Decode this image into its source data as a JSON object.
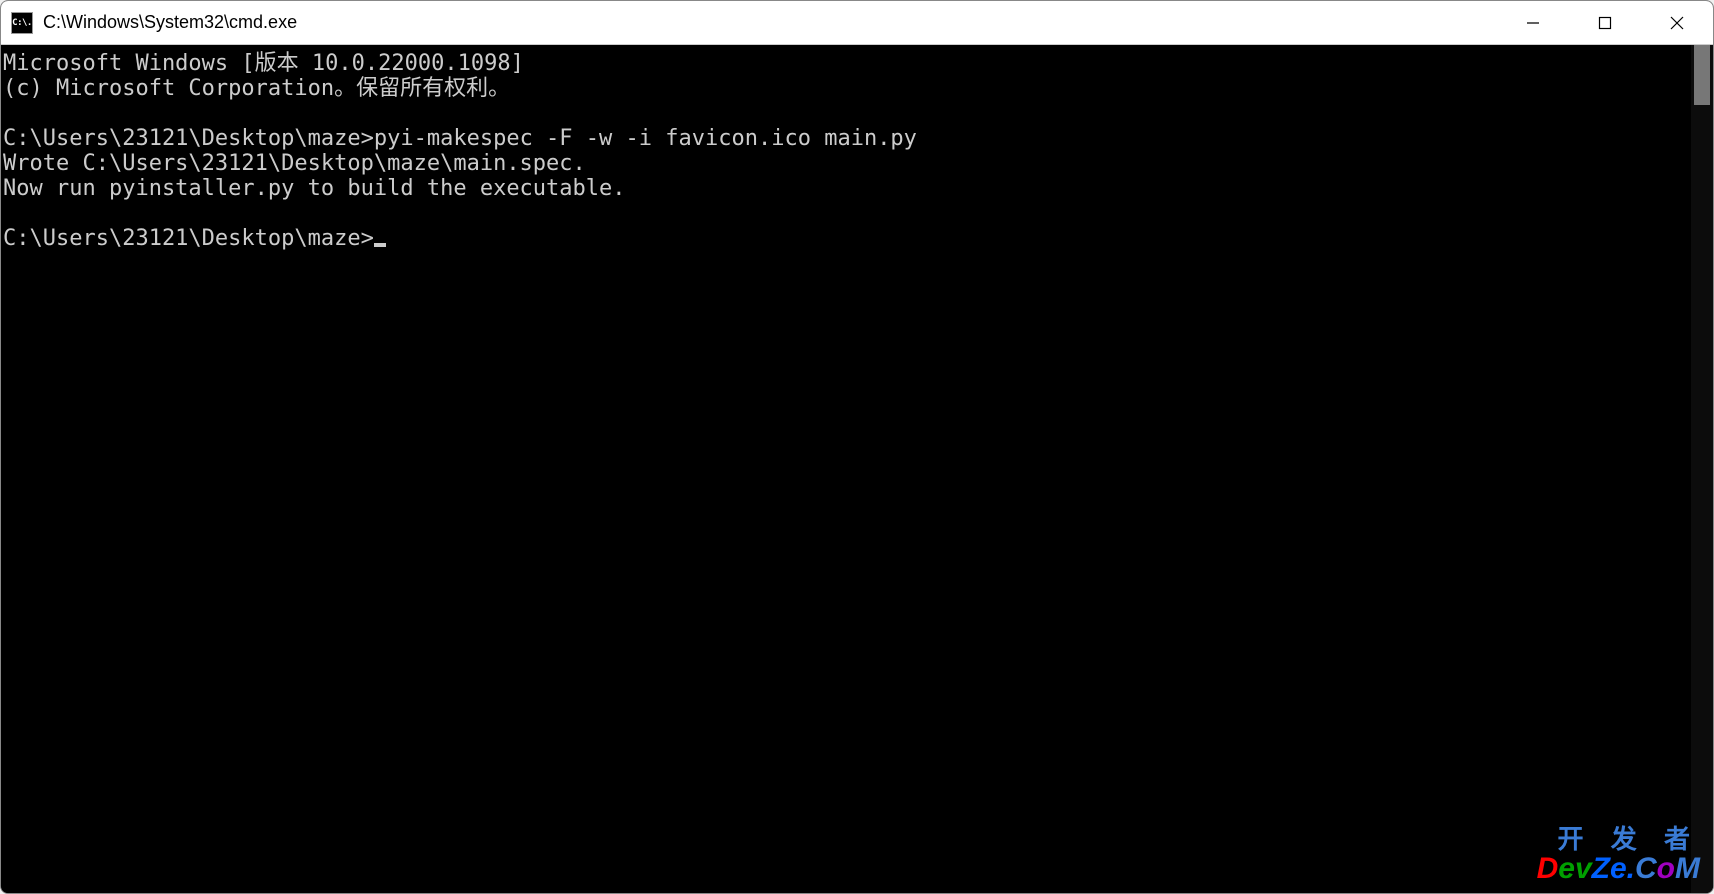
{
  "titlebar": {
    "icon_label": "C:\\.",
    "title": "C:\\Windows\\System32\\cmd.exe"
  },
  "terminal": {
    "line1": "Microsoft Windows [版本 10.0.22000.1098]",
    "line2": "(c) Microsoft Corporation。保留所有权利。",
    "line3": "",
    "line4_prompt": "C:\\Users\\23121\\Desktop\\maze>",
    "line4_command": "pyi-makespec -F -w -i favicon.ico main.py",
    "line5": "Wrote C:\\Users\\23121\\Desktop\\maze\\main.spec.",
    "line6": "Now run pyinstaller.py to build the executable.",
    "line7": "",
    "line8_prompt": "C:\\Users\\23121\\Desktop\\maze>"
  },
  "watermark": {
    "line1": "开 发 者",
    "line2": "DevZe.CoM"
  }
}
